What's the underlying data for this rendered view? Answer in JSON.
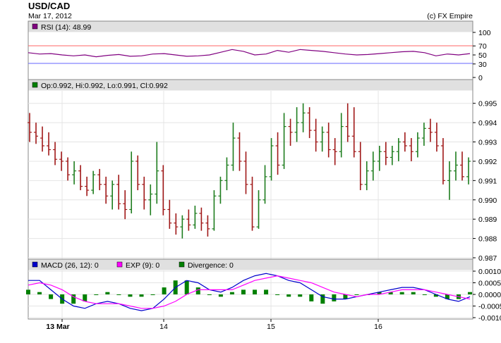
{
  "header": {
    "symbol": "USD/CAD",
    "date": "Mar 17, 2012",
    "credit": "(c) FX Empire"
  },
  "rsi_panel": {
    "label": "RSI (14): 48.99",
    "ticks": [
      "100",
      "70",
      "50",
      "30",
      "0"
    ]
  },
  "price_panel": {
    "label": "Op:0.992, Hi:0.992, Lo:0.991, Cl:0.992",
    "ticks": [
      "0.995",
      "0.994",
      "0.993",
      "0.992",
      "0.991",
      "0.990",
      "0.989",
      "0.988",
      "0.987"
    ]
  },
  "macd_panel": {
    "legend": [
      {
        "label": "MACD (26, 12): 0",
        "color": "#0000cc"
      },
      {
        "label": "EXP (9): 0",
        "color": "#ff00ff"
      },
      {
        "label": "Divergence: 0",
        "color": "#008000"
      }
    ],
    "ticks": [
      "0.0010",
      "0.0005",
      "0.0000",
      "-0.0005",
      "-0.0010"
    ]
  },
  "x_axis": {
    "labels": [
      "13 Mar",
      "14",
      "15",
      "16"
    ]
  },
  "colors": {
    "up": "#1e7d1e",
    "down": "#a01818",
    "rsi_line": "#800080",
    "rsi_70": "#ff6666",
    "rsi_30": "#6666ff",
    "panel_header_bg": "#e0e0e0",
    "panel_border": "#888888",
    "grid": "#e4e4e4"
  },
  "chart_data": [
    {
      "type": "line",
      "title": "RSI (14): 48.99",
      "ylim": [
        0,
        100
      ],
      "reference_lines": [
        70,
        30
      ],
      "x": [
        0,
        4,
        8,
        12,
        16,
        20,
        24,
        28,
        32,
        36,
        40,
        44,
        48,
        52,
        56,
        60,
        64,
        68,
        72,
        76,
        80,
        84,
        88,
        92,
        96,
        100,
        104,
        108,
        112,
        116,
        120,
        124,
        128,
        132,
        136,
        140,
        144,
        148,
        152,
        156
      ],
      "values": [
        55,
        52,
        53,
        50,
        48,
        50,
        46,
        49,
        51,
        47,
        48,
        52,
        53,
        50,
        47,
        48,
        50,
        56,
        62,
        58,
        50,
        52,
        60,
        56,
        62,
        60,
        58,
        55,
        52,
        50,
        51,
        53,
        55,
        57,
        58,
        55,
        48,
        52,
        50,
        53
      ]
    },
    {
      "type": "ohlc",
      "title": "Op:0.992, Hi:0.992, Lo:0.991, Cl:0.992",
      "ylim": [
        0.987,
        0.9955
      ],
      "x_labels": [
        "13 Mar",
        "14",
        "15",
        "16"
      ],
      "bars": [
        [
          0.994,
          0.9945,
          0.993,
          0.9935
        ],
        [
          0.9935,
          0.994,
          0.9929,
          0.9933
        ],
        [
          0.9932,
          0.9938,
          0.9925,
          0.9928
        ],
        [
          0.9928,
          0.9935,
          0.9923,
          0.9926
        ],
        [
          0.9926,
          0.993,
          0.9918,
          0.9921
        ],
        [
          0.9921,
          0.9925,
          0.9915,
          0.992
        ],
        [
          0.992,
          0.9922,
          0.991,
          0.9913
        ],
        [
          0.9913,
          0.992,
          0.9908,
          0.9915
        ],
        [
          0.9915,
          0.9918,
          0.9905,
          0.9907
        ],
        [
          0.9907,
          0.9912,
          0.9902,
          0.9905
        ],
        [
          0.9905,
          0.9915,
          0.9903,
          0.9913
        ],
        [
          0.9913,
          0.9916,
          0.9905,
          0.9908
        ],
        [
          0.9908,
          0.9912,
          0.9898,
          0.9902
        ],
        [
          0.9902,
          0.991,
          0.9895,
          0.9908
        ],
        [
          0.9908,
          0.9913,
          0.9895,
          0.9898
        ],
        [
          0.9898,
          0.9905,
          0.989,
          0.9895
        ],
        [
          0.9895,
          0.9925,
          0.9893,
          0.992
        ],
        [
          0.992,
          0.9923,
          0.9905,
          0.9908
        ],
        [
          0.9908,
          0.9912,
          0.9895,
          0.99
        ],
        [
          0.99,
          0.9908,
          0.9892,
          0.9903
        ],
        [
          0.9903,
          0.993,
          0.9898,
          0.9915
        ],
        [
          0.9915,
          0.9918,
          0.9892,
          0.9895
        ],
        [
          0.9895,
          0.99,
          0.9885,
          0.9888
        ],
        [
          0.9888,
          0.9893,
          0.9882,
          0.9886
        ],
        [
          0.9886,
          0.9892,
          0.988,
          0.989
        ],
        [
          0.989,
          0.9895,
          0.9884,
          0.9887
        ],
        [
          0.9887,
          0.9897,
          0.9885,
          0.9893
        ],
        [
          0.9893,
          0.9896,
          0.9884,
          0.9888
        ],
        [
          0.9888,
          0.9892,
          0.9881,
          0.9885
        ],
        [
          0.9885,
          0.9905,
          0.9884,
          0.9902
        ],
        [
          0.9902,
          0.9912,
          0.9898,
          0.991
        ],
        [
          0.991,
          0.9922,
          0.9905,
          0.9918
        ],
        [
          0.9918,
          0.994,
          0.9915,
          0.9932
        ],
        [
          0.9932,
          0.9935,
          0.9915,
          0.992
        ],
        [
          0.992,
          0.9925,
          0.9903,
          0.9908
        ],
        [
          0.9908,
          0.9912,
          0.9884,
          0.9886
        ],
        [
          0.9886,
          0.9905,
          0.9885,
          0.99
        ],
        [
          0.99,
          0.9918,
          0.9898,
          0.9912
        ],
        [
          0.9912,
          0.9932,
          0.991,
          0.9928
        ],
        [
          0.9928,
          0.9935,
          0.9913,
          0.9918
        ],
        [
          0.9918,
          0.9945,
          0.9916,
          0.9938
        ],
        [
          0.9938,
          0.9942,
          0.9928,
          0.9935
        ],
        [
          0.9935,
          0.9948,
          0.993,
          0.994
        ],
        [
          0.994,
          0.995,
          0.9935,
          0.9945
        ],
        [
          0.9945,
          0.9948,
          0.9932,
          0.9936
        ],
        [
          0.9936,
          0.9942,
          0.9925,
          0.993
        ],
        [
          0.993,
          0.9938,
          0.9925,
          0.9935
        ],
        [
          0.9935,
          0.994,
          0.9922,
          0.9926
        ],
        [
          0.9926,
          0.9932,
          0.9918,
          0.9925
        ],
        [
          0.9925,
          0.9945,
          0.9922,
          0.9938
        ],
        [
          0.9938,
          0.995,
          0.993,
          0.9933
        ],
        [
          0.9933,
          0.9948,
          0.9922,
          0.9925
        ],
        [
          0.9925,
          0.993,
          0.9905,
          0.9908
        ],
        [
          0.9908,
          0.992,
          0.9905,
          0.9915
        ],
        [
          0.9915,
          0.9925,
          0.991,
          0.992
        ],
        [
          0.992,
          0.9928,
          0.9915,
          0.9925
        ],
        [
          0.9925,
          0.993,
          0.9918,
          0.9922
        ],
        [
          0.9922,
          0.9928,
          0.9918,
          0.9925
        ],
        [
          0.9925,
          0.9932,
          0.992,
          0.993
        ],
        [
          0.993,
          0.9935,
          0.9925,
          0.9928
        ],
        [
          0.9928,
          0.9932,
          0.992,
          0.9925
        ],
        [
          0.9925,
          0.9935,
          0.9922,
          0.9932
        ],
        [
          0.9932,
          0.994,
          0.9928,
          0.9937
        ],
        [
          0.9937,
          0.9942,
          0.993,
          0.9935
        ],
        [
          0.9935,
          0.994,
          0.9925,
          0.9928
        ],
        [
          0.9928,
          0.9932,
          0.9908,
          0.991
        ],
        [
          0.991,
          0.992,
          0.99,
          0.9915
        ],
        [
          0.9915,
          0.9925,
          0.991,
          0.9918
        ],
        [
          0.9918,
          0.9925,
          0.991,
          0.9912
        ],
        [
          0.9912,
          0.9922,
          0.9908,
          0.992
        ]
      ]
    },
    {
      "type": "bar",
      "title": "MACD (26, 12): 0",
      "ylim": [
        -0.001,
        0.001
      ],
      "series": [
        {
          "name": "MACD (26, 12): 0",
          "values": [
            0.0006,
            0.0006,
            0.0002,
            -0.0002,
            -0.0005,
            -0.0006,
            -0.0004,
            -0.0003,
            -0.0004,
            -0.0006,
            -0.0007,
            -0.0006,
            -0.0002,
            0.0003,
            0.0006,
            0.0005,
            0.0002,
            0.0001,
            0.0003,
            0.0006,
            0.0008,
            0.0009,
            0.0008,
            0.0006,
            0.0005,
            0.0002,
            -0.0001,
            -0.0002,
            -0.0002,
            -0.0001,
            0.0,
            0.0001,
            0.0002,
            0.0003,
            0.0003,
            0.0002,
            0.0,
            -0.0002,
            -0.0003,
            -0.0001
          ]
        },
        {
          "name": "EXP (9): 0",
          "values": [
            0.0004,
            0.0005,
            0.0004,
            0.0002,
            -0.0001,
            -0.0003,
            -0.0004,
            -0.0004,
            -0.0004,
            -0.0005,
            -0.0006,
            -0.0006,
            -0.0005,
            -0.0003,
            0.0,
            0.0002,
            0.0002,
            0.0002,
            0.0002,
            0.0004,
            0.0006,
            0.0007,
            0.0008,
            0.0007,
            0.0006,
            0.0005,
            0.0003,
            0.0001,
            0.0,
            -0.0001,
            0.0,
            0.0,
            0.0001,
            0.0002,
            0.0002,
            0.0002,
            0.0001,
            0.0,
            -0.0001,
            -0.0002
          ]
        },
        {
          "name": "Divergence: 0",
          "values": [
            0.0002,
            0.0001,
            -0.0002,
            -0.0004,
            -0.0004,
            -0.0003,
            0.0,
            0.0001,
            0.0,
            -0.0001,
            -0.0001,
            0.0,
            0.0003,
            0.0006,
            0.0006,
            0.0003,
            0.0,
            -0.0001,
            0.0001,
            0.0002,
            0.0002,
            0.0002,
            0.0,
            -0.0001,
            -0.0001,
            -0.0003,
            -0.0004,
            -0.0003,
            -0.0002,
            0.0,
            0.0,
            0.0001,
            0.0001,
            0.0001,
            0.0001,
            0.0,
            -0.0001,
            -0.0002,
            -0.0002,
            0.0001
          ]
        }
      ]
    }
  ]
}
